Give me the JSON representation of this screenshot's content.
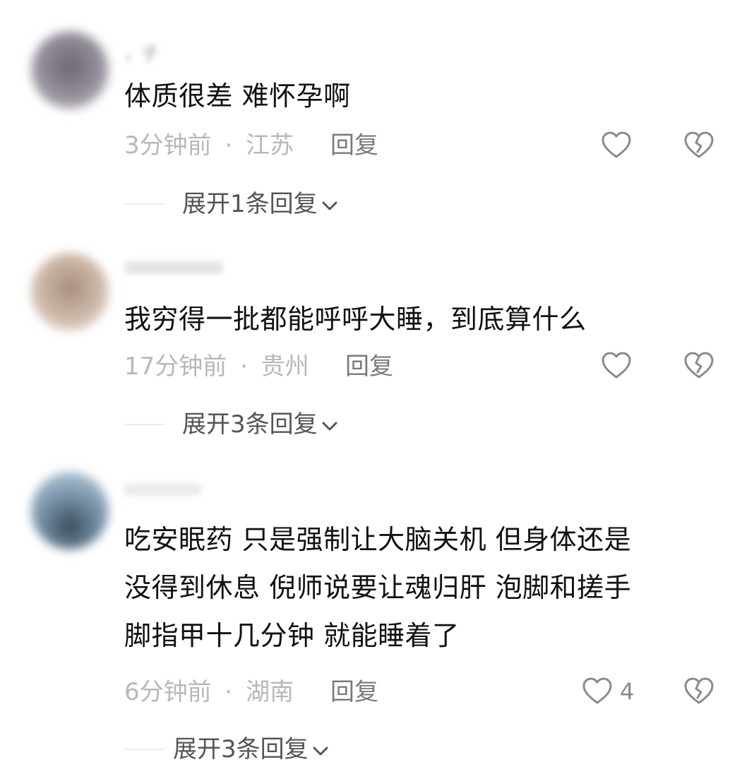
{
  "comments": [
    {
      "username": "，子",
      "content": "体质很差 难怀孕啊",
      "time": "3分钟前",
      "separator": "·",
      "location": "江苏",
      "reply_label": "回复",
      "like_count": "",
      "expand_label": "展开1条回复",
      "avatar_colors": [
        "#6e6874",
        "#8d8894",
        "#a9a4ae"
      ]
    },
    {
      "username": "",
      "content": "我穷得一批都能呼呼大睡，到底算什么",
      "time": "17分钟前",
      "separator": "·",
      "location": "贵州",
      "reply_label": "回复",
      "like_count": "",
      "expand_label": "展开3条回复",
      "avatar_colors": [
        "#a88e7b",
        "#c7b2a1",
        "#e3d6cb"
      ]
    },
    {
      "username": "",
      "content_lines": [
        "吃安眠药 只是强制让大脑关机 但身体还是",
        "没得到休息 倪师说要让魂归肝 泡脚和搓手",
        "脚指甲十几分钟 就能睡着了"
      ],
      "time": "6分钟前",
      "separator": "·",
      "location": "湖南",
      "reply_label": "回复",
      "like_count": "4",
      "expand_label": "展开3条回复",
      "avatar_colors": [
        "#3d4d5c",
        "#8fb1cc",
        "#c8dbe9"
      ]
    }
  ],
  "icons": {
    "like": "heart-outline-icon",
    "dislike": "broken-heart-icon",
    "expand": "chevron-down-icon"
  },
  "colors": {
    "meta_text": "#b8b8b8",
    "reply_text": "#7a7a7a",
    "icon_stroke": "#8a8a8a"
  }
}
